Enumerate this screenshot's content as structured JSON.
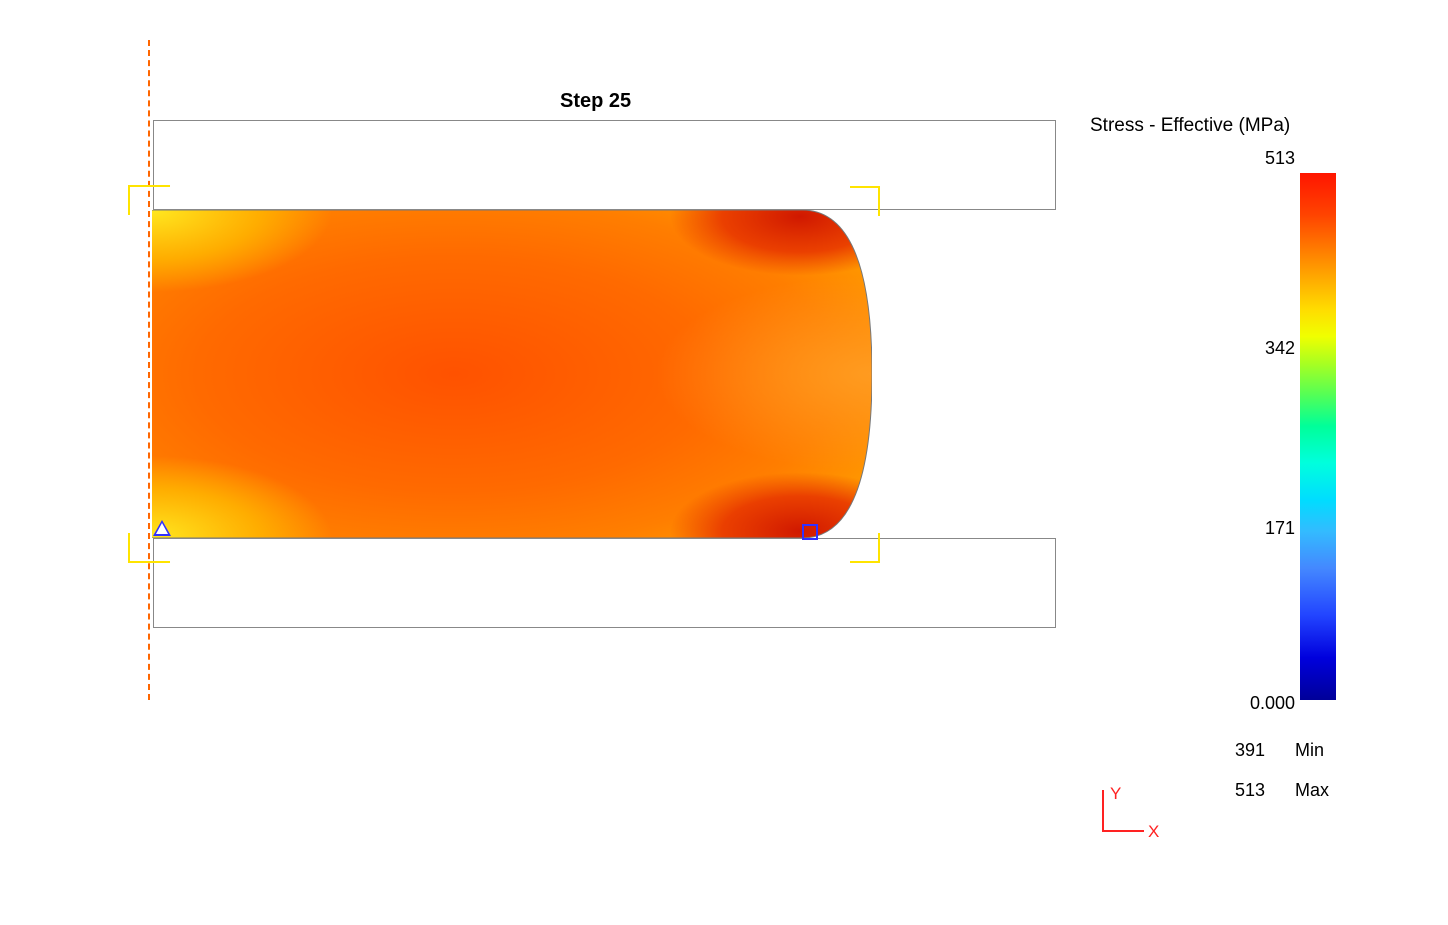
{
  "title": "Step   25",
  "legend": {
    "title": "Stress - Effective (MPa)",
    "ticks": {
      "max": "513",
      "t2": "342",
      "t1": "171",
      "min": "0.000"
    },
    "min_value": "391",
    "min_label": "Min",
    "max_value": "513",
    "max_label": "Max"
  },
  "axes": {
    "y": "Y",
    "x": "X"
  },
  "chart_data": {
    "type": "heatmap",
    "field": "Stress - Effective",
    "unit": "MPa",
    "step": 25,
    "color_scale": {
      "min": 0.0,
      "max": 513,
      "stops": [
        0.0,
        171,
        342,
        513
      ]
    },
    "data_range_displayed": {
      "min": 391,
      "max": 513
    },
    "geometry_note": "2D axisymmetric compression (flat dies, bulging billet). Axis of symmetry on left (dashed orange). Min marker (triangle) at lower-left contact edge; Max marker (square) near lower-right bulge-die contact corner.",
    "marker_min": {
      "symbol": "triangle",
      "value": 391
    },
    "marker_max": {
      "symbol": "square",
      "value": 513
    }
  }
}
